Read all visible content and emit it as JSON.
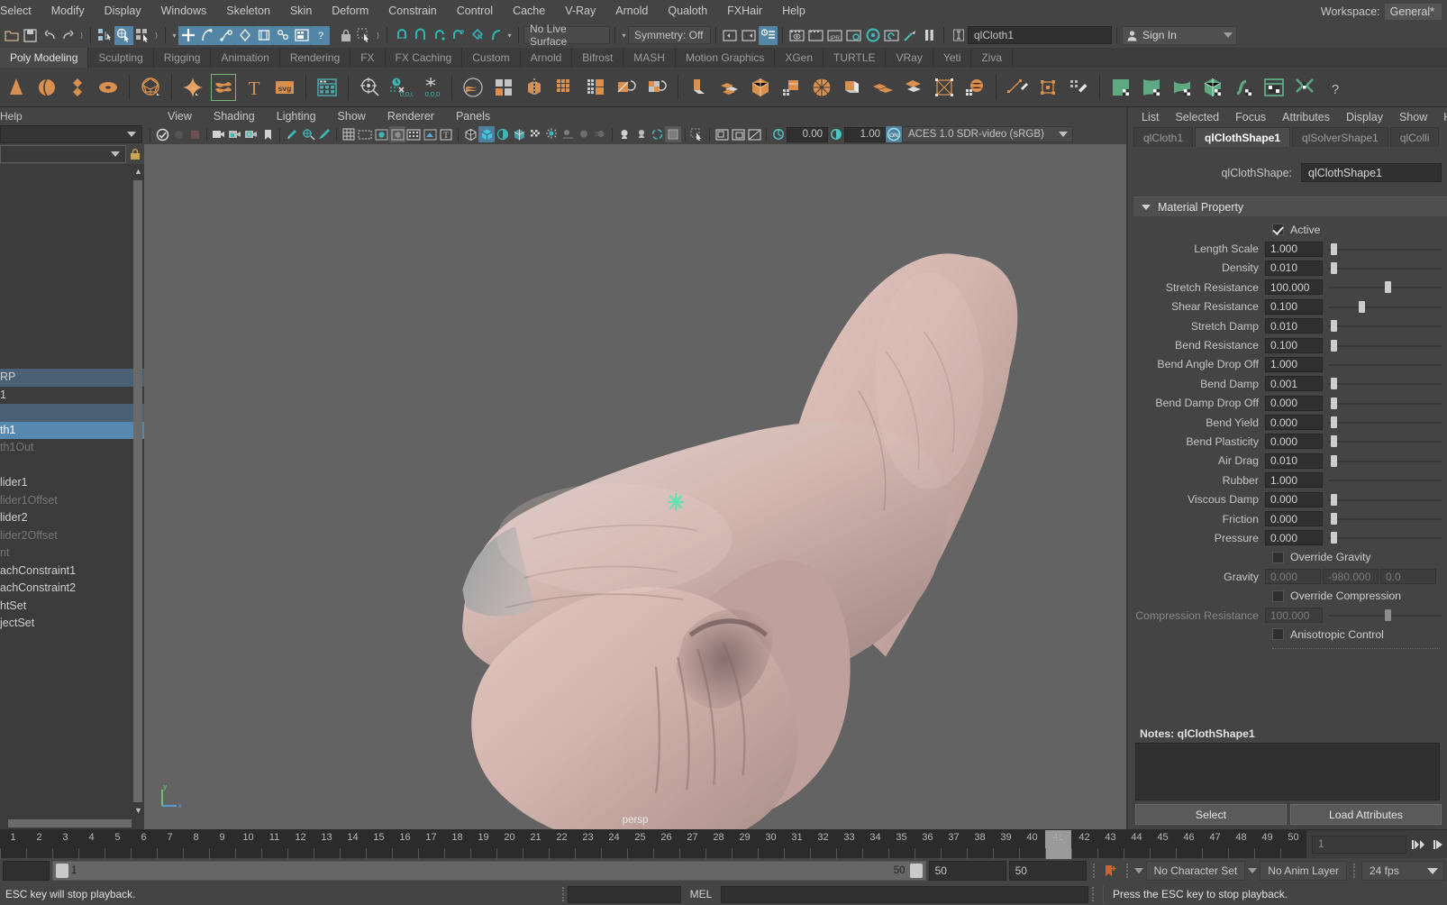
{
  "menubar": {
    "items": [
      "Select",
      "Modify",
      "Display",
      "Windows",
      "Skeleton",
      "Skin",
      "Deform",
      "Constrain",
      "Control",
      "Cache",
      "V-Ray",
      "Arnold",
      "Qualoth",
      "FXHair",
      "Help"
    ],
    "workspace_label": "Workspace:",
    "workspace_value": "General*"
  },
  "statusbar": {
    "no_live_surface": "No Live Surface",
    "symmetry": "Symmetry: Off",
    "object_name": "qlCloth1",
    "sign_in": "Sign In"
  },
  "shelf": {
    "tabs": [
      "Poly Modeling",
      "Sculpting",
      "Rigging",
      "Animation",
      "Rendering",
      "FX",
      "FX Caching",
      "Custom",
      "Arnold",
      "Bifrost",
      "MASH",
      "Motion Graphics",
      "XGen",
      "TURTLE",
      "VRay",
      "Yeti",
      "Ziva"
    ],
    "active_tab": "Poly Modeling"
  },
  "left_panel": {
    "menu": [
      "Help"
    ],
    "items": [
      {
        "label": "RP",
        "state": "sel-soft"
      },
      {
        "label": "1",
        "state": "normal"
      },
      {
        "label": "",
        "state": "sel-soft"
      },
      {
        "label": "th1",
        "state": "sel"
      },
      {
        "label": "th1Out",
        "state": "dim"
      },
      {
        "label": "",
        "state": "normal"
      },
      {
        "label": "lider1",
        "state": "normal"
      },
      {
        "label": "lider1Offset",
        "state": "dim"
      },
      {
        "label": "lider2",
        "state": "normal"
      },
      {
        "label": "lider2Offset",
        "state": "dim"
      },
      {
        "label": "nt",
        "state": "dim"
      },
      {
        "label": "achConstraint1",
        "state": "normal"
      },
      {
        "label": "achConstraint2",
        "state": "normal"
      },
      {
        "label": "htSet",
        "state": "normal"
      },
      {
        "label": "jectSet",
        "state": "normal"
      }
    ]
  },
  "viewport": {
    "menu": [
      "View",
      "Shading",
      "Lighting",
      "Show",
      "Renderer",
      "Panels"
    ],
    "exposure": "0.00",
    "gamma": "1.00",
    "color_space": "ACES 1.0 SDR-video (sRGB)",
    "camera_label": "persp"
  },
  "attribute_editor": {
    "menu": [
      "List",
      "Selected",
      "Focus",
      "Attributes",
      "Display",
      "Show",
      "Help"
    ],
    "tabs": [
      "qlCloth1",
      "qlClothShape1",
      "qlSolverShape1",
      "qlColli"
    ],
    "active_tab": "qlClothShape1",
    "shape_label": "qlClothShape:",
    "shape_value": "qlClothShape1",
    "section_title": "Material Property",
    "active_checkbox": {
      "label": "Active",
      "checked": true
    },
    "attributes": [
      {
        "label": "Length Scale",
        "value": "1.000",
        "knob_pct": 2
      },
      {
        "label": "Density",
        "value": "0.010",
        "knob_pct": 2
      },
      {
        "label": "Stretch Resistance",
        "value": "100.000",
        "knob_pct": 50
      },
      {
        "label": "Shear Resistance",
        "value": "0.100",
        "knob_pct": 27
      },
      {
        "label": "Stretch Damp",
        "value": "0.010",
        "knob_pct": 2
      },
      {
        "label": "Bend Resistance",
        "value": "0.100",
        "knob_pct": 2
      },
      {
        "label": "Bend Angle Drop Off",
        "value": "1.000",
        "knob_pct": -1
      },
      {
        "label": "Bend Damp",
        "value": "0.001",
        "knob_pct": 2
      },
      {
        "label": "Bend Damp Drop Off",
        "value": "0.000",
        "knob_pct": 2
      },
      {
        "label": "Bend Yield",
        "value": "0.000",
        "knob_pct": 2
      },
      {
        "label": "Bend Plasticity",
        "value": "0.000",
        "knob_pct": 2
      },
      {
        "label": "Air Drag",
        "value": "0.010",
        "knob_pct": 2
      },
      {
        "label": "Rubber",
        "value": "1.000",
        "knob_pct": -1
      },
      {
        "label": "Viscous Damp",
        "value": "0.000",
        "knob_pct": 2
      },
      {
        "label": "Friction",
        "value": "0.000",
        "knob_pct": 2
      },
      {
        "label": "Pressure",
        "value": "0.000",
        "knob_pct": 2
      }
    ],
    "override_gravity": {
      "label": "Override Gravity",
      "checked": false
    },
    "gravity": {
      "label": "Gravity",
      "x": "0.000",
      "y": "-980.000",
      "z": "0.0"
    },
    "override_compression": {
      "label": "Override Compression",
      "checked": false
    },
    "compression_resistance": {
      "label": "Compression Resistance",
      "value": "100.000",
      "knob_pct": 50
    },
    "anisotropic_control": {
      "label": "Anisotropic Control",
      "checked": false
    },
    "notes_label": "Notes:  qlClothShape1",
    "notes_value": "",
    "buttons": [
      "Select",
      "Load Attributes"
    ]
  },
  "timeline": {
    "start": 1,
    "end": 50,
    "current_frame": "41",
    "range_field": "1"
  },
  "playback": {
    "range_start": "1",
    "range_end": "50",
    "anim_end": "50",
    "playback_end": "50",
    "character_set": "No Character Set",
    "anim_layer": "No Anim Layer",
    "fps": "24 fps"
  },
  "command_line": {
    "help_text": "ESC key will stop playback.",
    "language": "MEL",
    "input_value": "",
    "status_text": "Press the ESC key to stop playback."
  },
  "colors": {
    "accent_blue": "#5285a6",
    "selection_blue": "#5789b0",
    "shelf_orange": "#d9904e",
    "shelf_teal": "#4aa5a5",
    "shelf_green": "#5ea882",
    "cloth_color": "#cfb0ab",
    "viewport_bg": "#636363"
  }
}
